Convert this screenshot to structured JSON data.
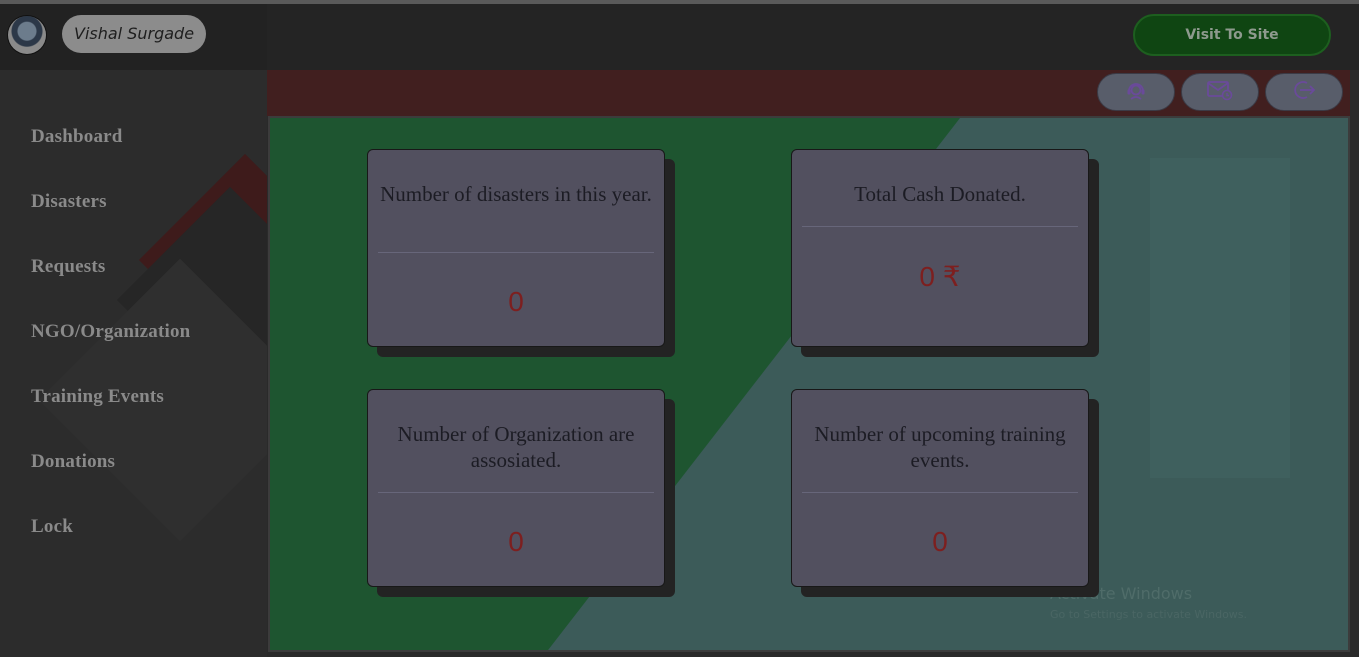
{
  "user": {
    "name": "Vishal Surgade"
  },
  "header": {
    "visit_button": "Visit To Site"
  },
  "toolbar": {
    "icons": [
      "support-agent-icon",
      "mail-icon",
      "logout-icon"
    ]
  },
  "sidebar": {
    "items": [
      {
        "label": "Dashboard"
      },
      {
        "label": "Disasters"
      },
      {
        "label": "Requests"
      },
      {
        "label": "NGO/Organization"
      },
      {
        "label": "Training Events"
      },
      {
        "label": "Donations"
      },
      {
        "label": "Lock"
      }
    ]
  },
  "cards": [
    {
      "title": "Number of disasters in this year.",
      "value": "0"
    },
    {
      "title": "Total Cash Donated.",
      "value": "0 ₹"
    },
    {
      "title": "Number of Organization are assosiated.",
      "value": "0"
    },
    {
      "title": "Number of upcoming training events.",
      "value": "0"
    }
  ],
  "watermark": {
    "title": "Activate Windows",
    "subtitle": "Go to Settings to activate Windows."
  },
  "colors": {
    "accent_green": "#0f4512",
    "header_red": "#411f1f",
    "value_red": "#7d1f1f",
    "card_bg": "#52505f"
  }
}
